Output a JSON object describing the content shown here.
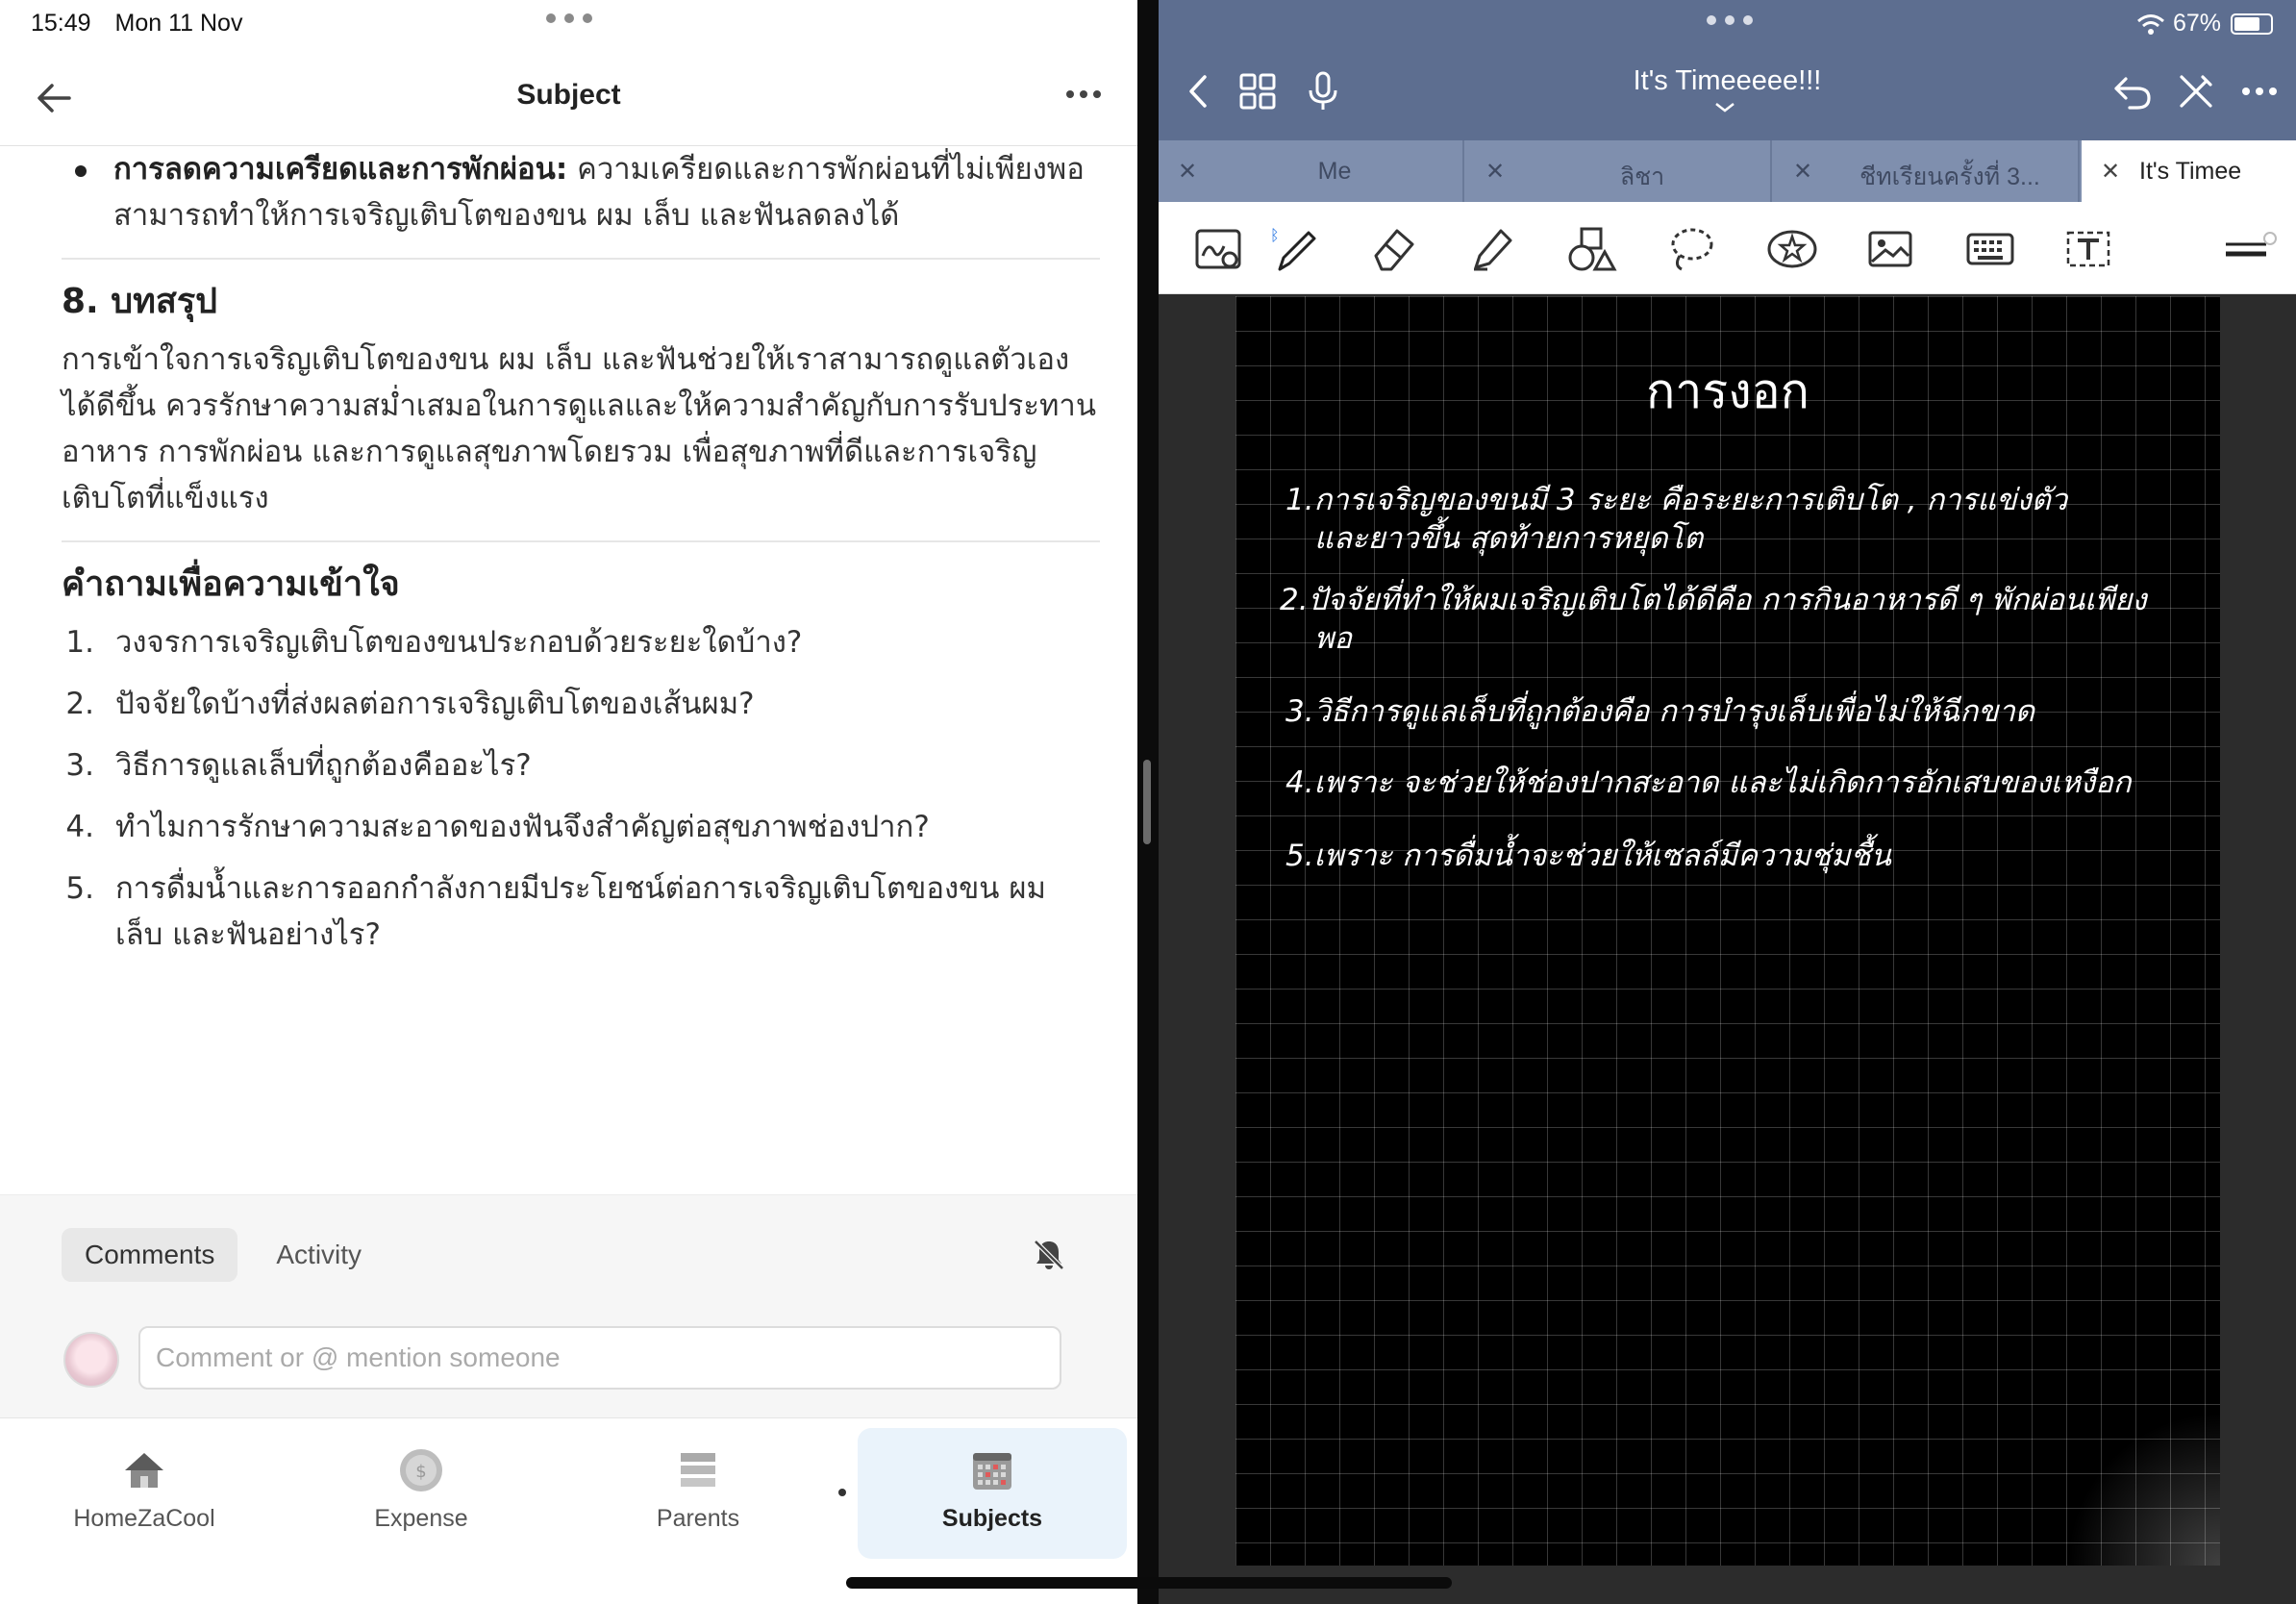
{
  "status": {
    "time": "15:49",
    "date": "Mon 11 Nov",
    "wifi": "wifi-icon",
    "battery": "67%"
  },
  "left": {
    "nav": {
      "title": "Subject"
    },
    "content": {
      "bullet": {
        "bold": "การลดความเครียดและการพักผ่อน:",
        "text": " ความเครียดและการพักผ่อนที่ไม่เพียงพอสามารถทำให้การเจริญเติบโตของขน ผม เล็บ และฟันลดลงได้"
      },
      "section8": {
        "heading": "8. บทสรุป",
        "para": "การเข้าใจการเจริญเติบโตของขน ผม เล็บ และฟันช่วยให้เราสามารถดูแลตัวเองได้ดีขึ้น ควรรักษาความสม่ำเสมอในการดูแลและให้ความสำคัญกับการรับประทานอาหาร การพักผ่อน และการดูแลสุขภาพโดยรวม เพื่อสุขภาพที่ดีและการเจริญเติบโตที่แข็งแรง"
      },
      "questions": {
        "heading": "คำถามเพื่อความเข้าใจ",
        "items": [
          {
            "num": "1.",
            "text": "วงจรการเจริญเติบโตของขนประกอบด้วยระยะใดบ้าง?"
          },
          {
            "num": "2.",
            "text": "ปัจจัยใดบ้างที่ส่งผลต่อการเจริญเติบโตของเส้นผม?"
          },
          {
            "num": "3.",
            "text": "วิธีการดูแลเล็บที่ถูกต้องคืออะไร?"
          },
          {
            "num": "4.",
            "text": "ทำไมการรักษาความสะอาดของฟันจึงสำคัญต่อสุขภาพช่องปาก?"
          },
          {
            "num": "5.",
            "text": "การดื่มน้ำและการออกกำลังกายมีประโยชน์ต่อการเจริญเติบโตของขน ผม เล็บ และฟันอย่างไร?"
          }
        ]
      }
    },
    "comments": {
      "tabs": [
        "Comments",
        "Activity"
      ],
      "placeholder": "Comment or @ mention someone"
    },
    "tabbar": [
      {
        "label": "HomeZaCool",
        "icon": "house-icon"
      },
      {
        "label": "Expense",
        "icon": "coin-icon"
      },
      {
        "label": "Parents",
        "icon": "stack-icon"
      },
      {
        "label": "Subjects",
        "icon": "calendar-grid-icon"
      }
    ]
  },
  "right": {
    "doc_title": "It's Timeeeee!!!",
    "tabs": [
      {
        "label": "Me"
      },
      {
        "label": "ลิชา"
      },
      {
        "label": "ชีทเรียนครั้งที่ 3..."
      },
      {
        "label": "It's Timee"
      }
    ],
    "page": {
      "title": "การงอก",
      "lines": [
        "1.การเจริญของขนมี 3 ระยะ คือระยะการเติบโต , การแข่งตัว",
        "และยาวขึ้น สุดท้ายการหยุดโต",
        "2.ปัจจัยที่ทำให้ผมเจริญเติบโตได้ดีคือ การกินอาหารดี ๆ พักผ่อนเพียง",
        "พอ",
        "3.วิธีการดูแลเล็บที่ถูกต้องคือ การบำรุงเล็บเพื่อไม่ให้ฉีกขาด",
        "4.เพราะ จะช่วยให้ช่องปากสะอาด และไม่เกิดการอักเสบของเหงือก",
        "5.เพราะ การดื่มน้ำจะช่วยให้เซลล์มีความชุ่มชื้น"
      ]
    }
  }
}
